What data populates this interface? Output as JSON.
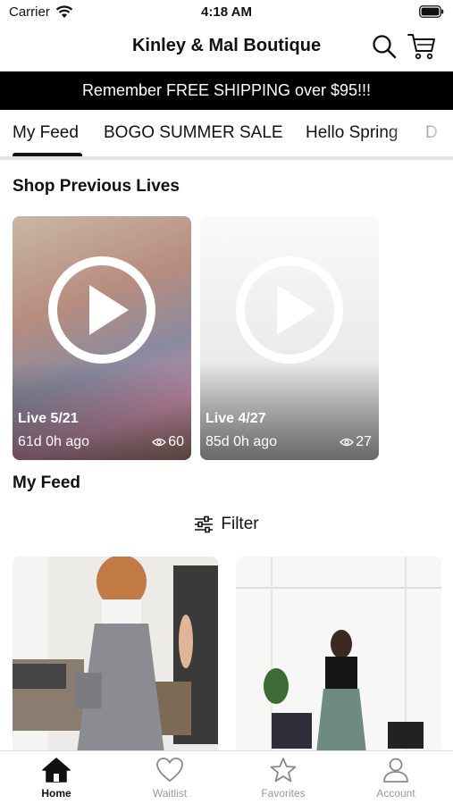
{
  "status_bar": {
    "carrier": "Carrier",
    "time": "4:18 AM"
  },
  "header": {
    "title": "Kinley & Mal Boutique"
  },
  "promo": {
    "text": "Remember FREE SHIPPING over $95!!!"
  },
  "tabs": [
    {
      "label": "My Feed",
      "active": true
    },
    {
      "label": "BOGO SUMMER SALE",
      "active": false
    },
    {
      "label": "Hello Spring",
      "active": false
    },
    {
      "label": "D",
      "active": false
    }
  ],
  "previous_lives": {
    "title": "Shop Previous Lives",
    "items": [
      {
        "label": "Live 5/21",
        "ago": "61d 0h ago",
        "views": "60"
      },
      {
        "label": "Live 4/27",
        "ago": "85d 0h ago",
        "views": "27"
      }
    ]
  },
  "feed": {
    "title": "My Feed",
    "filter_label": "Filter"
  },
  "tab_bar": [
    {
      "label": "Home",
      "icon": "home-icon",
      "active": true
    },
    {
      "label": "Waitlist",
      "icon": "heart-icon",
      "active": false
    },
    {
      "label": "Favorites",
      "icon": "star-icon",
      "active": false
    },
    {
      "label": "Account",
      "icon": "person-icon",
      "active": false
    }
  ]
}
